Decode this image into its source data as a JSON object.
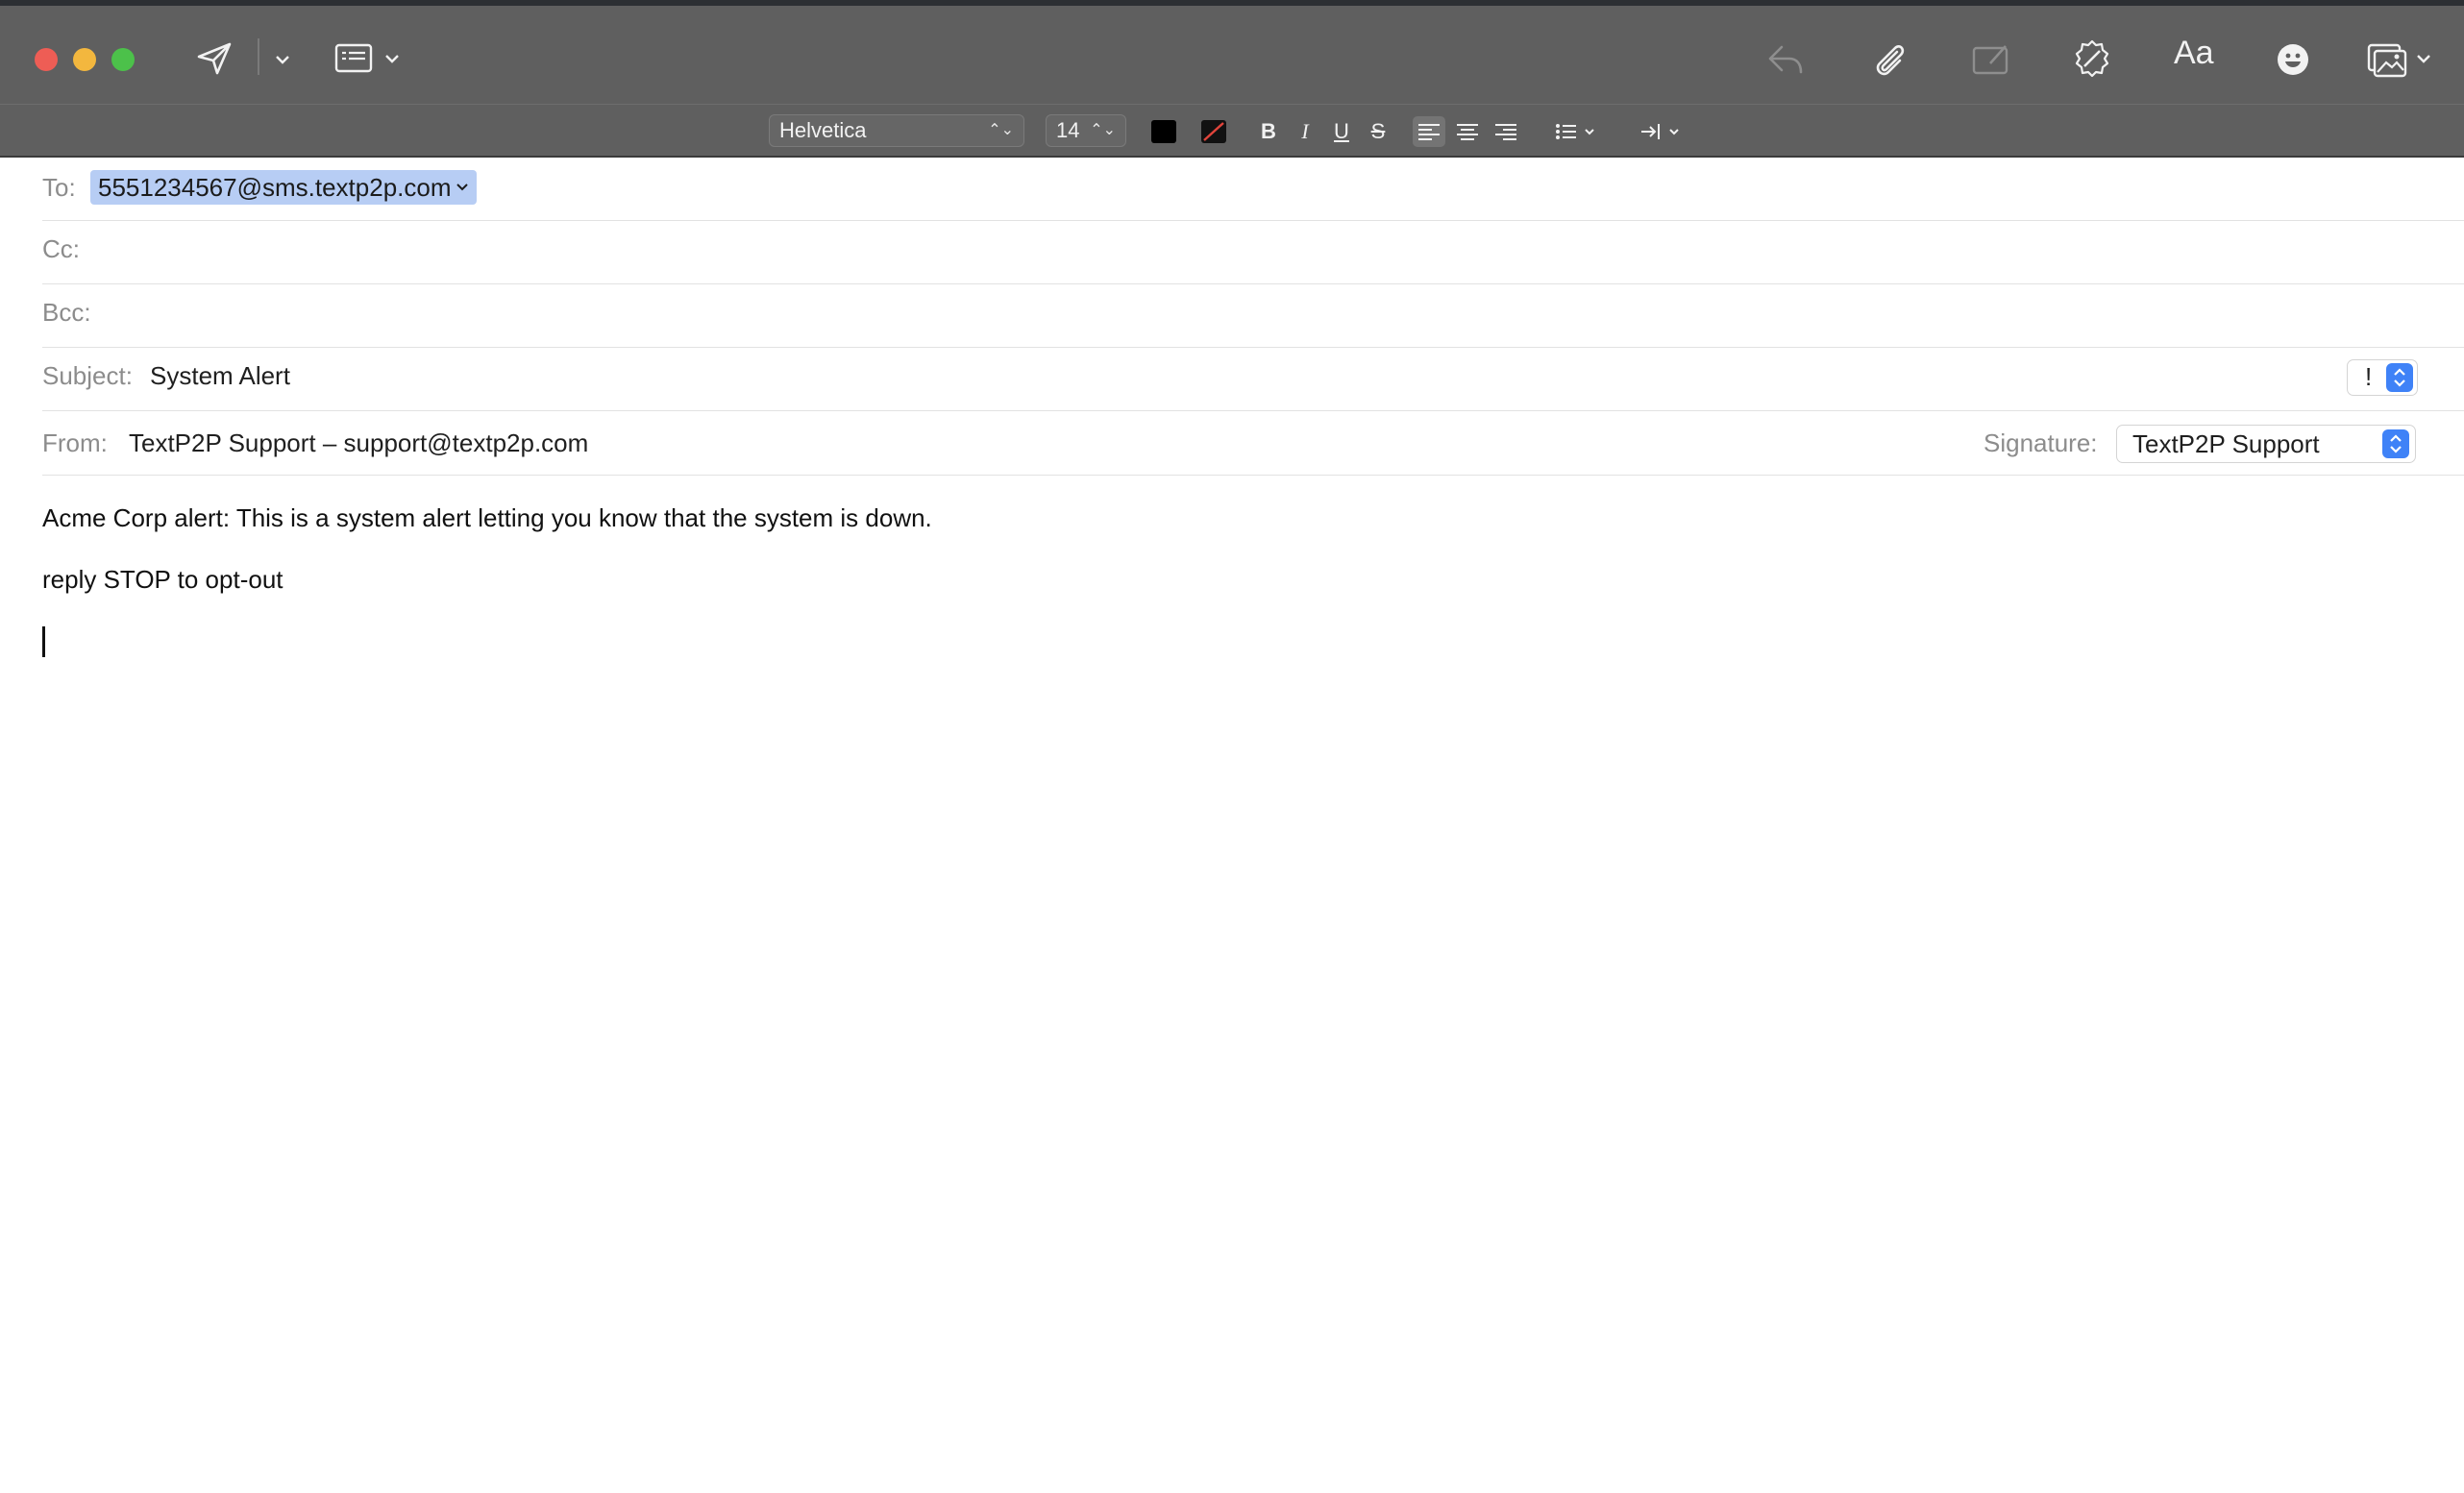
{
  "window": {
    "toolbar": {
      "send_icon": "paper-plane-icon",
      "header_fields_icon": "header-fields-icon",
      "reply_icon": "reply-icon",
      "attach_icon": "paperclip-icon",
      "markup_icon": "markup-icon",
      "rewrite_icon": "writing-tools-icon",
      "format_label": "Aa",
      "emoji_icon": "emoji-icon",
      "photo_icon": "photo-browser-icon"
    },
    "format": {
      "font_family": "Helvetica",
      "font_size": "14",
      "text_color": "#000000",
      "bold_label": "B",
      "italic_label": "I",
      "underline_label": "U",
      "strike_label": "S",
      "list_icon": "list-icon",
      "indent_icon": "indent-icon"
    }
  },
  "header": {
    "to_label": "To:",
    "to_value": "5551234567@sms.textp2p.com",
    "cc_label": "Cc:",
    "bcc_label": "Bcc:",
    "subject_label": "Subject:",
    "subject_value": "System Alert",
    "priority_value": "!",
    "from_label": "From:",
    "from_value": "TextP2P Support – support@textp2p.com",
    "signature_label": "Signature:",
    "signature_value": "TextP2P Support"
  },
  "body": {
    "lines": [
      "Acme Corp alert: This is a system alert letting you know that the system is down.",
      "reply STOP to opt-out"
    ]
  },
  "colors": {
    "toolbar_bg": "#5f5f5f",
    "recipient_highlight": "#b7cdf4",
    "accent": "#3f82f7"
  }
}
